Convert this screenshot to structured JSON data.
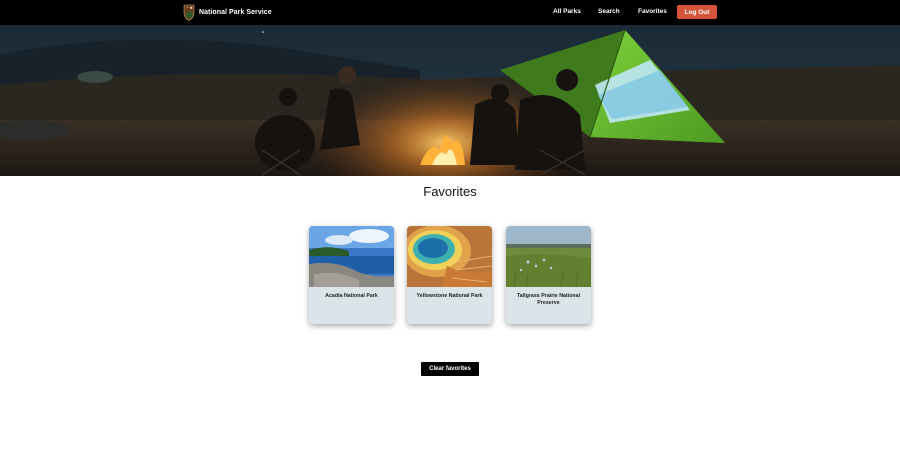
{
  "nav": {
    "brand_name": "National Park Service",
    "brand_icon": "arrowhead-logo-icon",
    "links": [
      "All Parks",
      "Search",
      "Favorites"
    ],
    "logout_label": "Log Out"
  },
  "hero": {
    "image": "campfire-camping-tent-night-photo"
  },
  "page": {
    "title": "Favorites"
  },
  "favorites": [
    {
      "name": "Acadia National Park",
      "image": "rocky-coastline-photo"
    },
    {
      "name": "Yellowstone National Park",
      "image": "grand-prismatic-spring-photo"
    },
    {
      "name": "Tallgrass Prairie National Preserve",
      "image": "prairie-grassland-photo"
    }
  ],
  "actions": {
    "clear_label": "Clear favorites"
  },
  "colors": {
    "nav_bg": "#000000",
    "logout_bg": "#d6543a",
    "card_bg": "#dbe4e8",
    "clear_bg": "#000000"
  }
}
